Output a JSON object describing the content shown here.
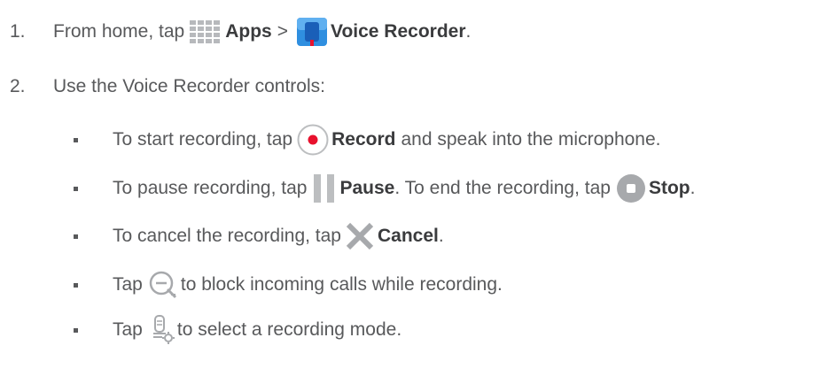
{
  "steps": [
    {
      "num": "1.",
      "t1": "From home, tap",
      "b1": "Apps",
      "t2": ">",
      "b2": "Voice Recorder",
      "t3": "."
    },
    {
      "num": "2.",
      "t1": "Use the Voice Recorder controls:"
    }
  ],
  "bullets": [
    {
      "t1": "To start recording, tap",
      "b1": "Record",
      "t2": "and speak into the microphone."
    },
    {
      "t1": "To pause recording, tap",
      "b1": "Pause",
      "t2": ". To end the recording, tap",
      "b2": "Stop",
      "t3": "."
    },
    {
      "t1": "To cancel the recording, tap",
      "b1": "Cancel",
      "t2": "."
    },
    {
      "t1": "Tap",
      "t2": "to block incoming calls while recording."
    },
    {
      "t1": "Tap",
      "t2": "to select a recording mode."
    }
  ],
  "icons": {
    "apps": "apps-grid-icon",
    "voice_recorder": "voice-recorder-app-icon",
    "record": "record-icon",
    "pause": "pause-icon",
    "stop": "stop-icon",
    "cancel": "cancel-x-icon",
    "block_calls": "block-calls-icon",
    "recording_mode": "recording-mode-icon"
  },
  "colors": {
    "text": "#58595b",
    "bold": "#3a3b3d",
    "record_red": "#e8112d",
    "icon_gray": "#bcbec0",
    "app_blue": "#1a7fd4"
  }
}
